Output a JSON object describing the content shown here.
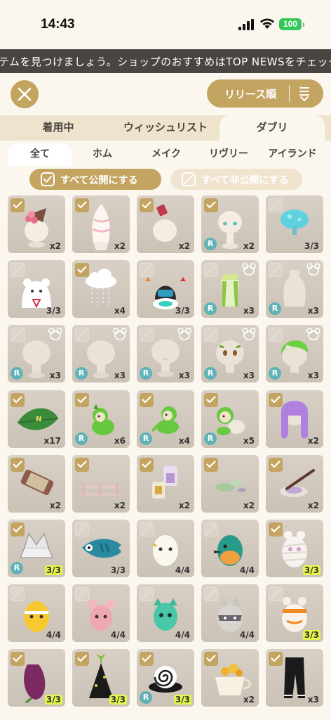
{
  "status": {
    "time": "14:43",
    "battery": "100"
  },
  "ticker": "テムを見つけましょう。ショップのおすすめはTOP NEWSをチェック！",
  "sort_label": "リリース順",
  "tabs": [
    {
      "label": "着用中"
    },
    {
      "label": "ウィッシュリスト"
    },
    {
      "label": "ダブリ",
      "active": true
    }
  ],
  "subtabs": [
    {
      "label": "全て",
      "active": true
    },
    {
      "label": "ホム"
    },
    {
      "label": "メイク"
    },
    {
      "label": "リヴリー"
    },
    {
      "label": "アイランド"
    }
  ],
  "actions": {
    "publish_all": "すべて公開にする",
    "unpublish_all": "すべて非公開にする"
  },
  "colors": {
    "gold": "#c3a461",
    "dark": "#4a4541",
    "bg": "#fbf7ef",
    "rare": "#5fb3b8",
    "full_count": "#e5f74a"
  },
  "items": [
    {
      "name": "cake-hat",
      "checked": true,
      "rare": false,
      "mouse": false,
      "count": "x2",
      "full": false
    },
    {
      "name": "soft-serve",
      "checked": true,
      "rare": false,
      "mouse": false,
      "count": "x2",
      "full": false
    },
    {
      "name": "red-clip",
      "checked": true,
      "rare": false,
      "mouse": false,
      "count": "x2",
      "full": false
    },
    {
      "name": "face-eyes",
      "checked": true,
      "rare": true,
      "mouse": false,
      "count": "x2",
      "full": false
    },
    {
      "name": "blue-mushroom",
      "checked": false,
      "rare": false,
      "mouse": false,
      "count": "3/3",
      "full": false
    },
    {
      "name": "bear-ghost",
      "checked": false,
      "rare": false,
      "mouse": false,
      "count": "3/3",
      "full": false
    },
    {
      "name": "rain-cloud",
      "checked": true,
      "rare": false,
      "mouse": false,
      "count": "x4",
      "full": false
    },
    {
      "name": "robot",
      "checked": false,
      "rare": false,
      "mouse": false,
      "count": "3/3",
      "full": false
    },
    {
      "name": "green-outfit",
      "checked": false,
      "rare": true,
      "mouse": true,
      "count": "x3",
      "full": false
    },
    {
      "name": "bottle-body",
      "checked": false,
      "rare": true,
      "mouse": true,
      "count": "x3",
      "full": false
    },
    {
      "name": "head-1",
      "checked": false,
      "rare": true,
      "mouse": true,
      "count": "x3",
      "full": false
    },
    {
      "name": "head-2",
      "checked": false,
      "rare": true,
      "mouse": true,
      "count": "x3",
      "full": false
    },
    {
      "name": "head-3",
      "checked": false,
      "rare": true,
      "mouse": true,
      "count": "x3",
      "full": false
    },
    {
      "name": "head-4",
      "checked": false,
      "rare": true,
      "mouse": true,
      "count": "x3",
      "full": false
    },
    {
      "name": "green-hair",
      "checked": false,
      "rare": true,
      "mouse": true,
      "count": "x3",
      "full": false
    },
    {
      "name": "leaf",
      "checked": true,
      "rare": false,
      "mouse": false,
      "count": "x17",
      "full": false
    },
    {
      "name": "green-pet-1",
      "checked": true,
      "rare": true,
      "mouse": false,
      "count": "x6",
      "full": false
    },
    {
      "name": "green-pet-2",
      "checked": true,
      "rare": true,
      "mouse": false,
      "count": "x4",
      "full": false
    },
    {
      "name": "green-pet-3",
      "checked": true,
      "rare": true,
      "mouse": false,
      "count": "x5",
      "full": false
    },
    {
      "name": "purple-hair",
      "checked": true,
      "rare": false,
      "mouse": false,
      "count": "x2",
      "full": false
    },
    {
      "name": "scroll",
      "checked": true,
      "rare": false,
      "mouse": false,
      "count": "x2",
      "full": false
    },
    {
      "name": "fence",
      "checked": true,
      "rare": false,
      "mouse": false,
      "count": "x2",
      "full": false
    },
    {
      "name": "bottles",
      "checked": true,
      "rare": false,
      "mouse": false,
      "count": "x2",
      "full": false
    },
    {
      "name": "green-stones",
      "checked": true,
      "rare": false,
      "mouse": false,
      "count": "x2",
      "full": false
    },
    {
      "name": "paint-brush",
      "checked": true,
      "rare": false,
      "mouse": false,
      "count": "x2",
      "full": false
    },
    {
      "name": "kabuto",
      "checked": true,
      "rare": true,
      "mouse": false,
      "count": "3/3",
      "full": true
    },
    {
      "name": "koinobori",
      "checked": false,
      "rare": false,
      "mouse": false,
      "count": "3/3",
      "full": false
    },
    {
      "name": "egg-white",
      "checked": false,
      "rare": false,
      "mouse": false,
      "count": "4/4",
      "full": false
    },
    {
      "name": "egg-kingfisher",
      "checked": false,
      "rare": false,
      "mouse": false,
      "count": "4/4",
      "full": false
    },
    {
      "name": "egg-mummy",
      "checked": true,
      "rare": false,
      "mouse": false,
      "count": "3/3",
      "full": true
    },
    {
      "name": "egg-yellow",
      "checked": false,
      "rare": false,
      "mouse": false,
      "count": "4/4",
      "full": false
    },
    {
      "name": "egg-pink",
      "checked": false,
      "rare": false,
      "mouse": false,
      "count": "4/4",
      "full": false
    },
    {
      "name": "egg-green",
      "checked": false,
      "rare": false,
      "mouse": false,
      "count": "4/4",
      "full": false
    },
    {
      "name": "egg-raccoon",
      "checked": false,
      "rare": false,
      "mouse": false,
      "count": "4/4",
      "full": false
    },
    {
      "name": "egg-orange",
      "checked": false,
      "rare": false,
      "mouse": false,
      "count": "3/3",
      "full": true
    },
    {
      "name": "sweet-potato",
      "checked": true,
      "rare": false,
      "mouse": false,
      "count": "3/3",
      "full": true
    },
    {
      "name": "party-hat",
      "checked": true,
      "rare": false,
      "mouse": false,
      "count": "3/3",
      "full": true
    },
    {
      "name": "spiral-hat",
      "checked": true,
      "rare": true,
      "mouse": false,
      "count": "3/3",
      "full": true
    },
    {
      "name": "flower-cup",
      "checked": true,
      "rare": false,
      "mouse": false,
      "count": "x2",
      "full": false
    },
    {
      "name": "black-pants",
      "checked": true,
      "rare": false,
      "mouse": false,
      "count": "x3",
      "full": false
    }
  ]
}
